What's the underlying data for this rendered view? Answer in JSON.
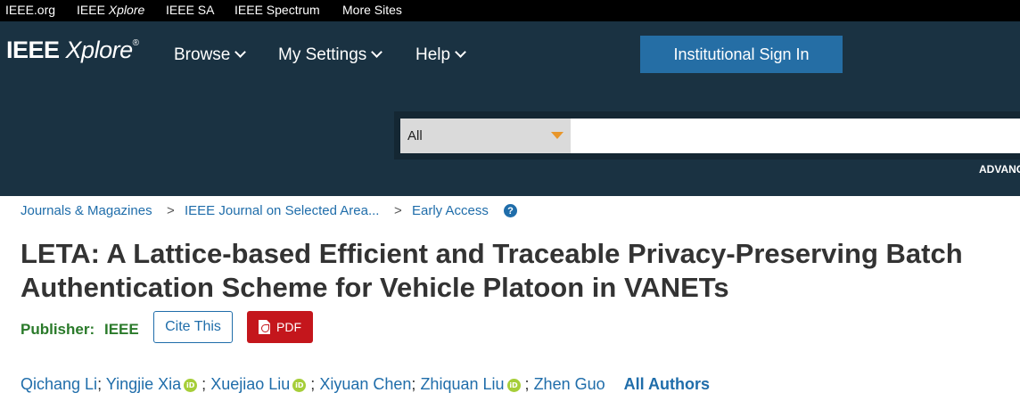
{
  "topbar": {
    "links": [
      {
        "label": "IEEE.org"
      },
      {
        "label_pre": "IEEE ",
        "label_em": "Xplore"
      },
      {
        "label": "IEEE SA"
      },
      {
        "label": "IEEE Spectrum"
      },
      {
        "label": "More Sites"
      }
    ]
  },
  "header": {
    "logo": {
      "bold": "IEEE",
      "italic": "Xplore",
      "reg": "®"
    },
    "nav": [
      {
        "label": "Browse"
      },
      {
        "label": "My Settings"
      },
      {
        "label": "Help"
      }
    ],
    "signin_label": "Institutional Sign In",
    "search": {
      "scope": "All",
      "value": "",
      "advanced_label": "ADVANC"
    }
  },
  "breadcrumb": [
    {
      "label": "Journals & Magazines"
    },
    {
      "label": "IEEE Journal on Selected Area..."
    },
    {
      "label": "Early Access"
    }
  ],
  "breadcrumb_separator": ">",
  "help_icon_label": "?",
  "article": {
    "title_line1": "LETA: A Lattice-based Efficient and Traceable Privacy-Preserving Batch",
    "title_line2": "Authentication Scheme for Vehicle Platoon in VANETs",
    "publisher_label": "Publisher:",
    "publisher_name": "IEEE",
    "cite_label": "Cite This",
    "pdf_label": "PDF"
  },
  "authors": [
    {
      "name": "Qichang Li",
      "orcid": false
    },
    {
      "name": "Yingjie Xia",
      "orcid": true
    },
    {
      "name": "Xuejiao Liu",
      "orcid": true
    },
    {
      "name": "Xiyuan Chen",
      "orcid": false
    },
    {
      "name": "Zhiquan Liu",
      "orcid": true
    },
    {
      "name": "Zhen Guo",
      "orcid": false
    }
  ],
  "author_separator": ";",
  "orcid_icon_text": "iD",
  "all_authors_label": "All Authors",
  "colors": {
    "header_bg": "#1a3242",
    "accent_blue": "#256ea5",
    "link_blue": "#1f6daa",
    "pdf_red": "#c4161c",
    "publisher_green": "#2a7a2a",
    "orcid_green": "#a6ce39"
  }
}
